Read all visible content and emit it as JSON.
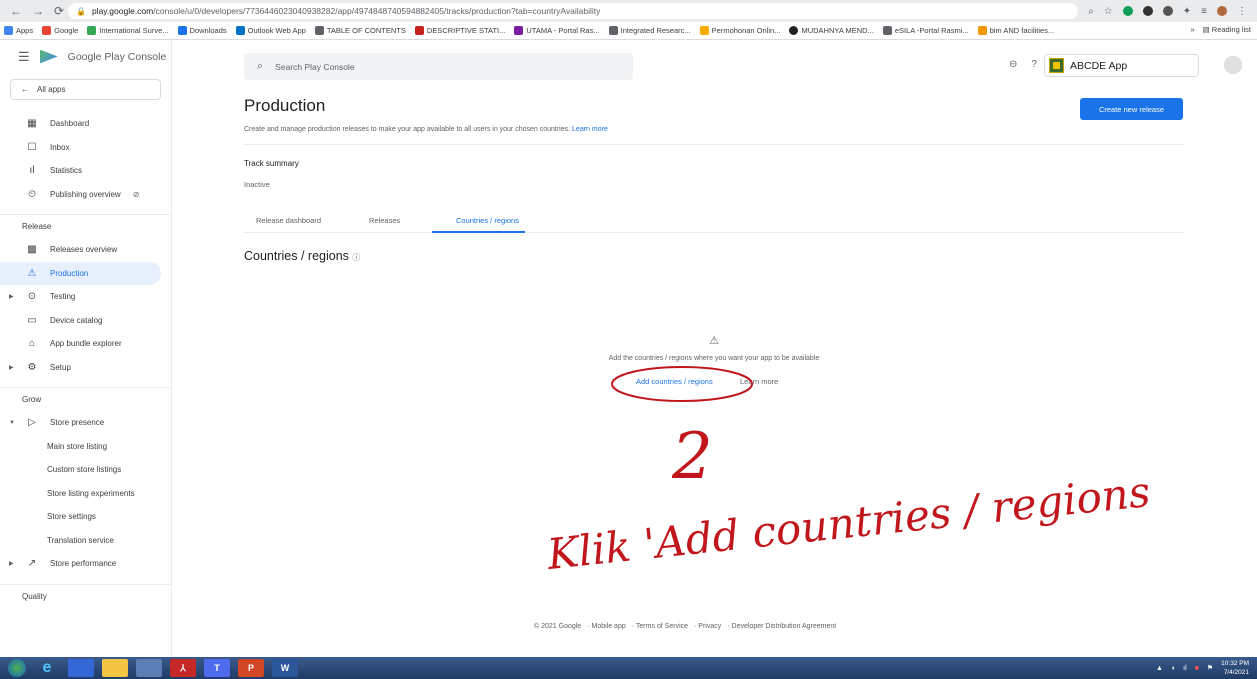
{
  "browser": {
    "url_host": "play.google.com",
    "url_path": "/console/u/0/developers/7736446023040938282/app/4974848740594882405/tracks/production?tab=countryAvailability",
    "bookmarks": [
      "Apps",
      "Google",
      "International Surve...",
      "Downloads",
      "Outlook Web App",
      "TABLE OF CONTENTS",
      "DESCRIPTIVE STATI...",
      "UTAMA - Portal Ras...",
      "Integrated Researc...",
      "Permohonan Onlin...",
      "MUDAHNYA MEND...",
      "eSILA -Portal Rasmi...",
      "bim AND facilities..."
    ],
    "reading_list": "Reading list"
  },
  "sidebar": {
    "brand": "Google Play Console",
    "all_apps": "All apps",
    "items": [
      {
        "label": "Dashboard",
        "icon": "dashboard-icon"
      },
      {
        "label": "Inbox",
        "icon": "inbox-icon"
      },
      {
        "label": "Statistics",
        "icon": "statistics-icon"
      },
      {
        "label": "Publishing overview",
        "icon": "publishing-icon"
      }
    ],
    "release_section": "Release",
    "release_items": [
      {
        "label": "Releases overview",
        "icon": "releases-overview-icon"
      },
      {
        "label": "Production",
        "icon": "production-icon"
      },
      {
        "label": "Testing",
        "icon": "testing-icon"
      },
      {
        "label": "Device catalog",
        "icon": "device-catalog-icon"
      },
      {
        "label": "App bundle explorer",
        "icon": "app-bundle-icon"
      },
      {
        "label": "Setup",
        "icon": "setup-icon"
      }
    ],
    "grow_section": "Grow",
    "store_presence": "Store presence",
    "store_sub": [
      "Main store listing",
      "Custom store listings",
      "Store listing experiments",
      "Store settings",
      "Translation service"
    ],
    "store_performance": "Store performance",
    "quality_section": "Quality"
  },
  "topbar": {
    "search_placeholder": "Search Play Console",
    "app_name": "ABCDE App"
  },
  "main": {
    "title": "Production",
    "description": "Create and manage production releases to make your app available to all users in your chosen countries.",
    "learn_more": "Learn more",
    "create_button": "Create new release",
    "track_summary_label": "Track summary",
    "track_summary_value": "Inactive",
    "tabs": [
      "Release dashboard",
      "Releases",
      "Countries / regions"
    ],
    "section_title": "Countries / regions",
    "empty_text": "Add the countries / regions where you want your app to be available",
    "add_link": "Add countries / regions",
    "learn_more_link": "Learn more"
  },
  "footer": [
    "© 2021 Google",
    "Mobile app",
    "Terms of Service",
    "Privacy",
    "Developer Distribution Agreement"
  ],
  "taskbar": {
    "time": "10:32 PM",
    "date": "7/4/2021"
  },
  "annotation": {
    "step_number": "2",
    "instruction": "Klik 'Add countries / regions"
  }
}
